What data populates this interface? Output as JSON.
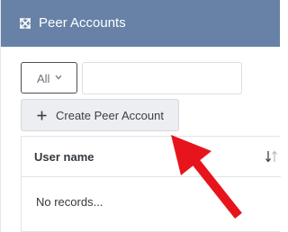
{
  "panel": {
    "title": "Peer Accounts",
    "header_color": "#6782a6",
    "header_icon": "expand-icon"
  },
  "filter": {
    "selected": "All",
    "icon": "chevron-down-icon"
  },
  "search": {
    "value": "",
    "placeholder": ""
  },
  "create_button": {
    "label": "Create Peer Account",
    "icon": "plus-icon"
  },
  "table": {
    "columns": [
      "User name"
    ],
    "sort_icon": "sort-arrows-icon",
    "empty_message": "No records..."
  },
  "annotation": {
    "color": "#e8141c",
    "type": "arrow"
  }
}
